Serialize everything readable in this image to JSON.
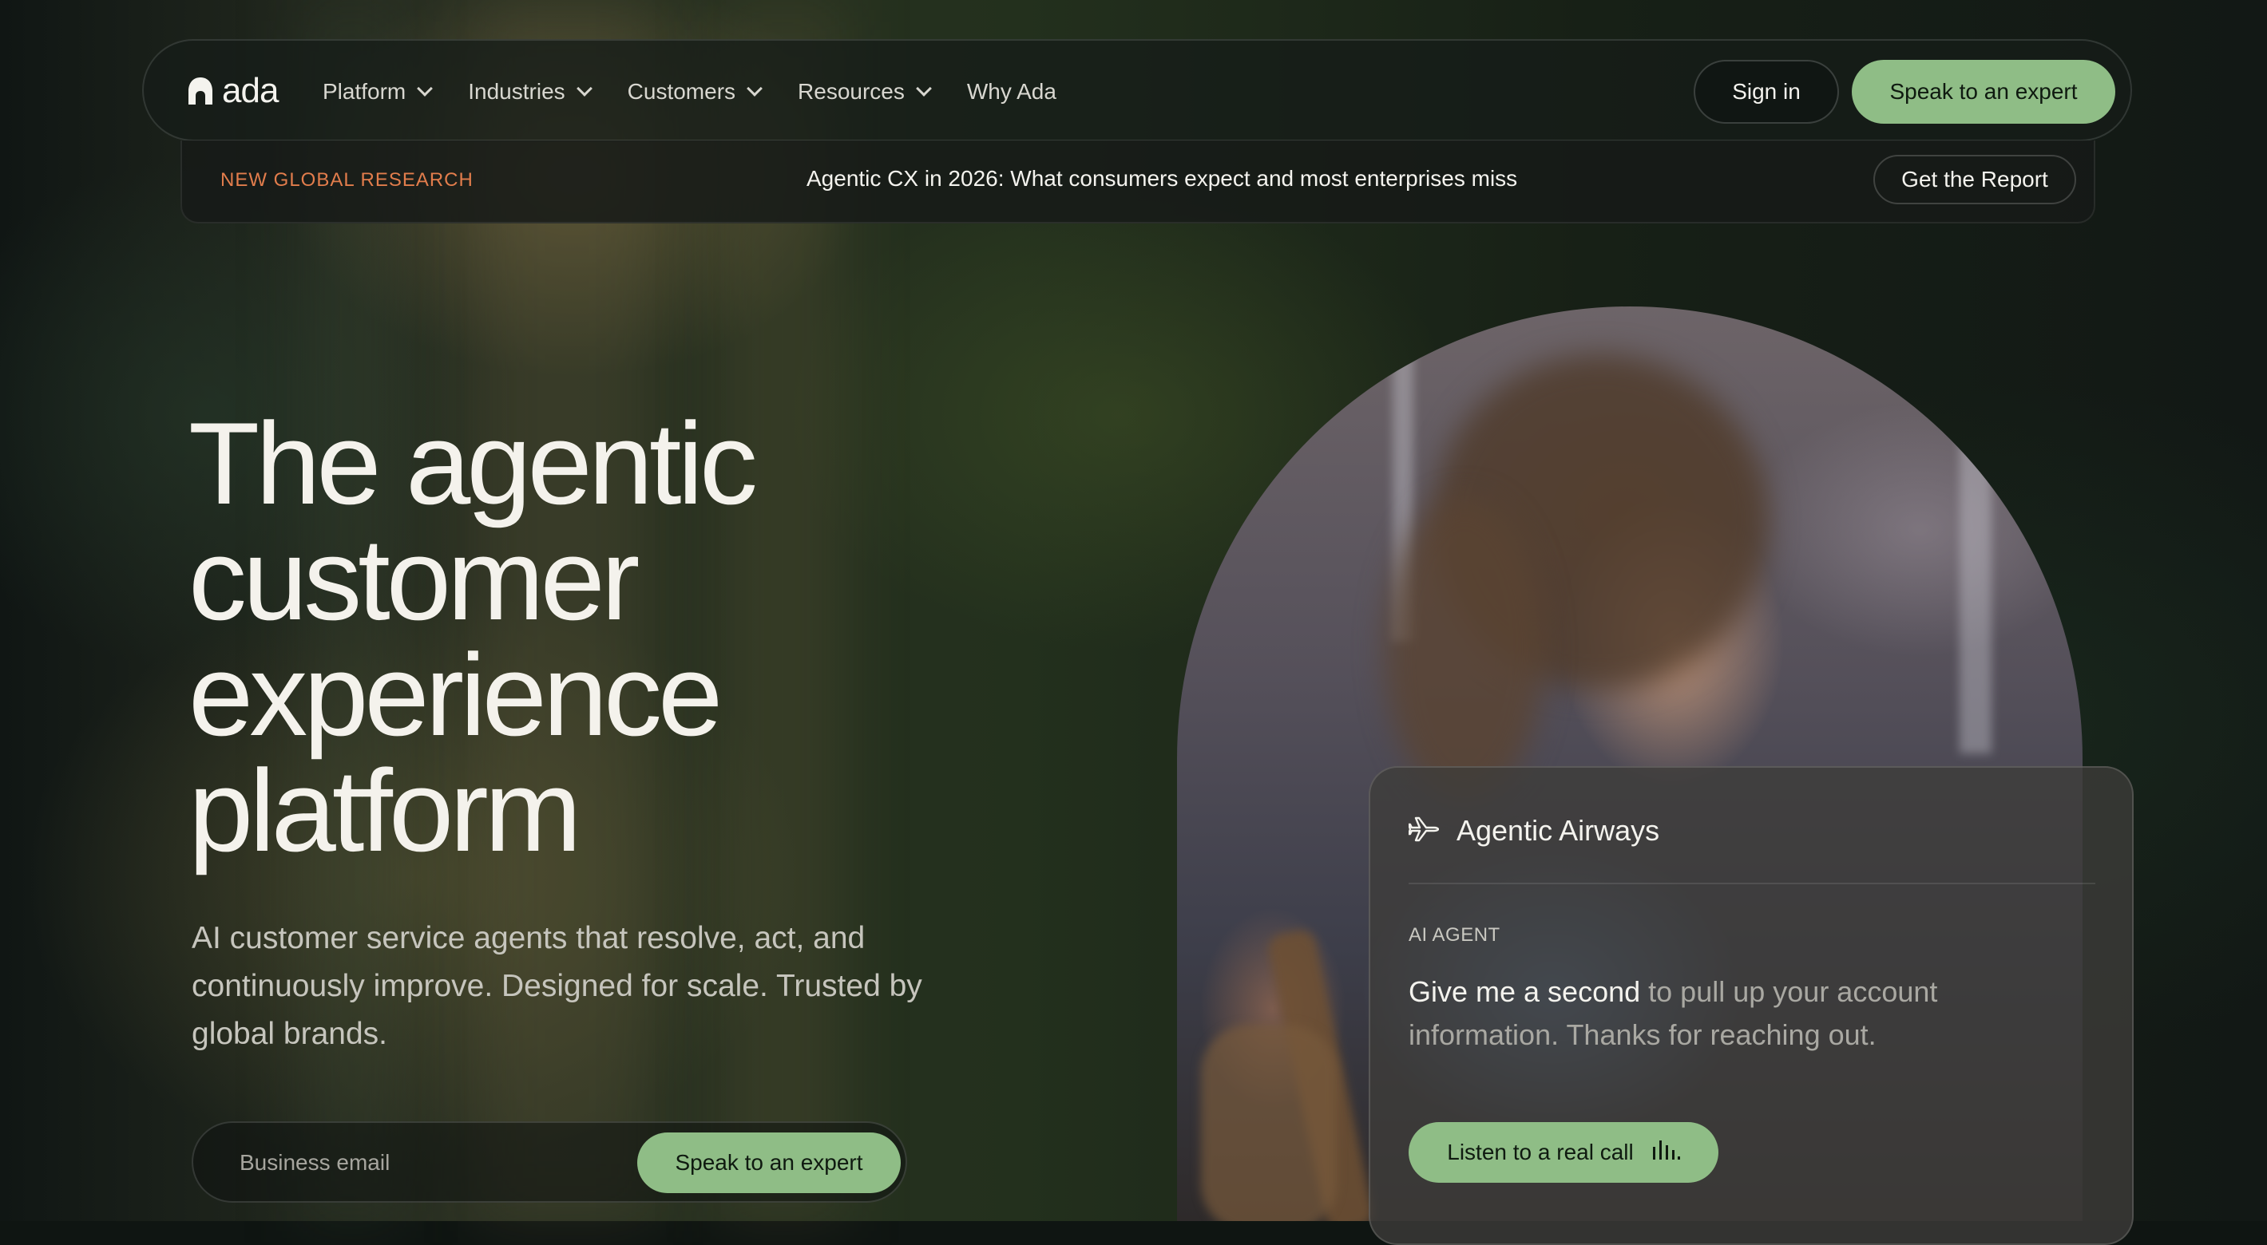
{
  "brand": {
    "name": "ada"
  },
  "nav": {
    "items": [
      {
        "label": "Platform",
        "dropdown": true
      },
      {
        "label": "Industries",
        "dropdown": true
      },
      {
        "label": "Customers",
        "dropdown": true
      },
      {
        "label": "Resources",
        "dropdown": true
      },
      {
        "label": "Why Ada",
        "dropdown": false
      }
    ],
    "sign_in": "Sign in",
    "cta": "Speak to an expert"
  },
  "banner": {
    "tag": "NEW GLOBAL RESEARCH",
    "text": "Agentic CX in 2026: What consumers expect and most enterprises miss",
    "button": "Get the Report"
  },
  "hero": {
    "title_lines": [
      "The agentic",
      "customer",
      "experience",
      "platform"
    ],
    "subtitle": "AI customer service agents that resolve, act, and continuously improve. Designed for scale. Trusted by global brands.",
    "email_placeholder": "Business email",
    "cta": "Speak to an expert"
  },
  "card": {
    "title": "Agentic Airways",
    "icon": "plane-icon",
    "label": "AI AGENT",
    "message_strong": "Give me a second",
    "message_rest": " to pull up your account information. Thanks for reaching out.",
    "button": "Listen to a real call",
    "button_icon": "audio-bars-icon"
  },
  "colors": {
    "accent_green": "#8fbd86",
    "tag_orange": "#e27d4c"
  }
}
